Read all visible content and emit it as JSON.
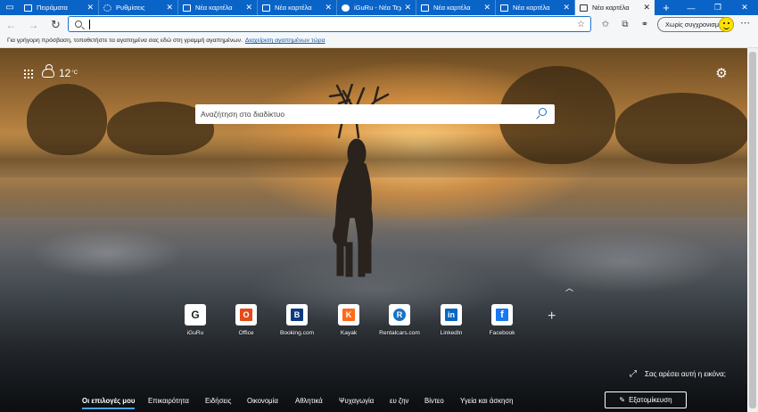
{
  "tabs": [
    {
      "label": "Πειράματα",
      "icon": "experiments-icon"
    },
    {
      "label": "Ρυθμίσεις",
      "icon": "settings-icon"
    },
    {
      "label": "Νέα καρτέλα",
      "icon": "newtab-icon"
    },
    {
      "label": "Νέα καρτέλα",
      "icon": "newtab-icon"
    },
    {
      "label": "iGuRu - Νέα Τεχνολ...",
      "icon": "iguru-icon"
    },
    {
      "label": "Νέα καρτέλα",
      "icon": "newtab-icon"
    },
    {
      "label": "Νέα καρτέλα",
      "icon": "newtab-icon"
    },
    {
      "label": "Νέα καρτέλα",
      "icon": "newtab-icon"
    }
  ],
  "toolbar": {
    "address_value": "",
    "profile_label": "Χωρίς συγχρονισμό"
  },
  "favorites_bar": {
    "message": "Για γρήγορη πρόσβαση, τοποθετήστε τα αγαπημένα σας εδώ στη γραμμή αγαπημένων.",
    "link": "Διαχείριση αγαπημένων τώρα"
  },
  "weather": {
    "temp": "12",
    "unit": "°C",
    "icon": "cloud-icon"
  },
  "search": {
    "placeholder": "Αναζήτηση στο διαδίκτυο"
  },
  "quick_links": [
    {
      "label": "iGuRu",
      "letter": "G",
      "color": "#222222"
    },
    {
      "label": "Office",
      "letter": "O",
      "color": "#e64a19"
    },
    {
      "label": "Booking.com",
      "letter": "B",
      "color": "#0a3a82"
    },
    {
      "label": "Kayak",
      "letter": "K",
      "color": "#ff6a1a"
    },
    {
      "label": "Rentalcars.com",
      "letter": "R",
      "color": "#1671c8"
    },
    {
      "label": "LinkedIn",
      "letter": "in",
      "color": "#0a66c2"
    },
    {
      "label": "Facebook",
      "letter": "f",
      "color": "#1877f2"
    }
  ],
  "like_image": "Σας αρέσει αυτή η εικόνα;",
  "bottom_nav": [
    "Οι επιλογές μου",
    "Επικαιρότητα",
    "Ειδήσεις",
    "Οικονομία",
    "Αθλητικά",
    "Ψυχαγωγία",
    "ευ ζην",
    "Βίντεο",
    "Υγεία και άσκηση"
  ],
  "customize_label": "Εξατομίκευση"
}
